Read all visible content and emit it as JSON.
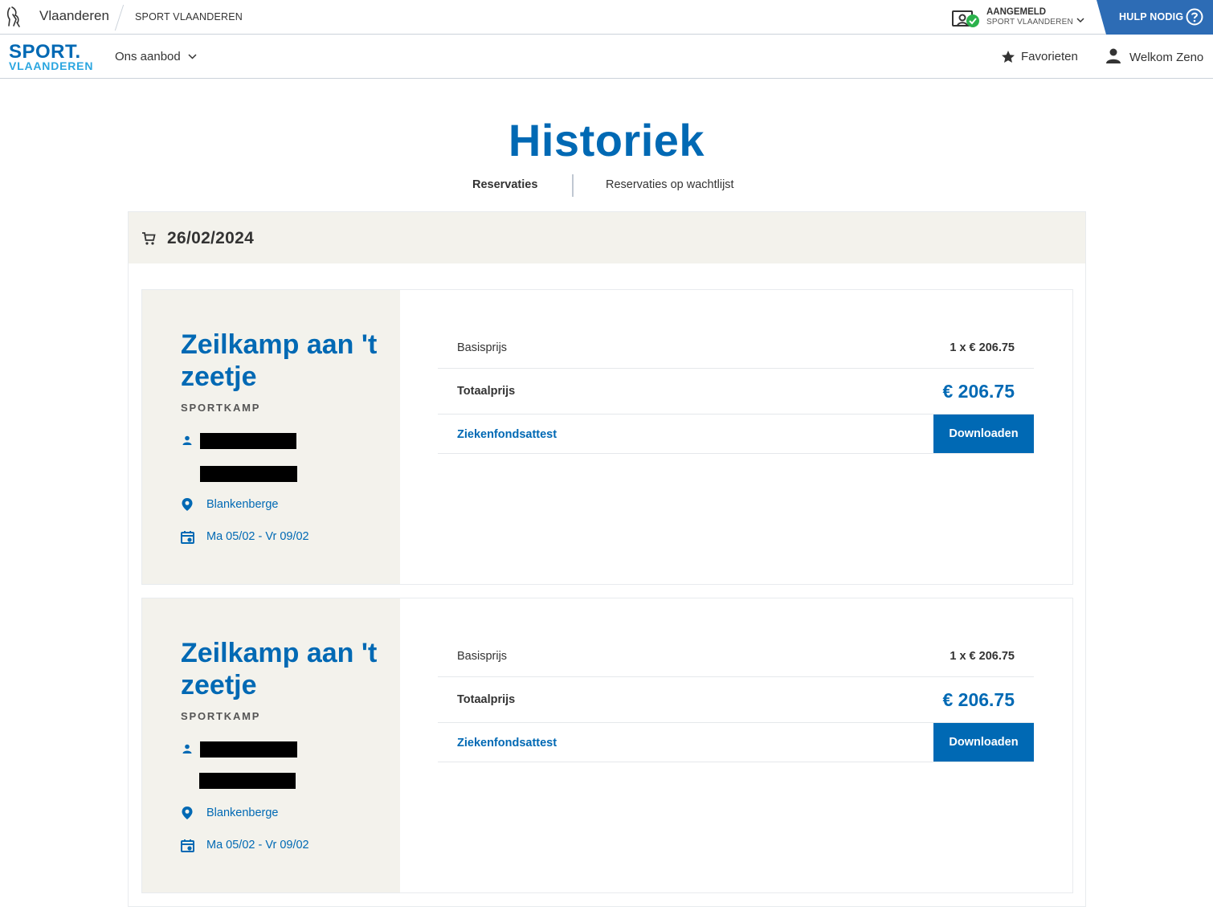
{
  "global_header": {
    "brand": "Vlaanderen",
    "org": "SPORT VLAANDEREN",
    "account_status": "AANGEMELD",
    "account_org": "SPORT VLAANDEREN",
    "help_label": "HULP NODIG"
  },
  "site_nav": {
    "logo_line1": "SPORT.",
    "logo_line2": "VLAANDEREN",
    "menu_label": "Ons aanbod",
    "favorites_label": "Favorieten",
    "welcome_label": "Welkom Zeno"
  },
  "page": {
    "title": "Historiek",
    "tabs": [
      {
        "label": "Reservaties",
        "active": true
      },
      {
        "label": "Reservaties op wachtlijst",
        "active": false
      }
    ]
  },
  "order": {
    "date": "26/02/2024",
    "items": [
      {
        "title": "Zeilkamp aan 't zeetje",
        "type": "SPORTKAMP",
        "location": "Blankenberge",
        "dates": "Ma 05/02 - Vr 09/02",
        "base_label": "Basisprijs",
        "base_value": "1 x € 206.75",
        "total_label": "Totaalprijs",
        "total_value": "€ 206.75",
        "attest_label": "Ziekenfondsattest",
        "download_label": "Downloaden"
      },
      {
        "title": "Zeilkamp aan 't zeetje",
        "type": "SPORTKAMP",
        "location": "Blankenberge",
        "dates": "Ma 05/02 - Vr 09/02",
        "base_label": "Basisprijs",
        "base_value": "1 x € 206.75",
        "total_label": "Totaalprijs",
        "total_value": "€ 206.75",
        "attest_label": "Ziekenfondsattest",
        "download_label": "Downloaden"
      }
    ]
  },
  "colors": {
    "primary": "#0069b4",
    "help_bg": "#2d6cb5",
    "panel_bg": "#f3f2ec",
    "success": "#2bb24c"
  },
  "icons": [
    "flemish-lion-icon",
    "account-check-icon",
    "chevron-down-icon",
    "help-circle-icon",
    "star-icon",
    "user-icon",
    "cart-icon",
    "pin-icon",
    "calendar-icon"
  ]
}
